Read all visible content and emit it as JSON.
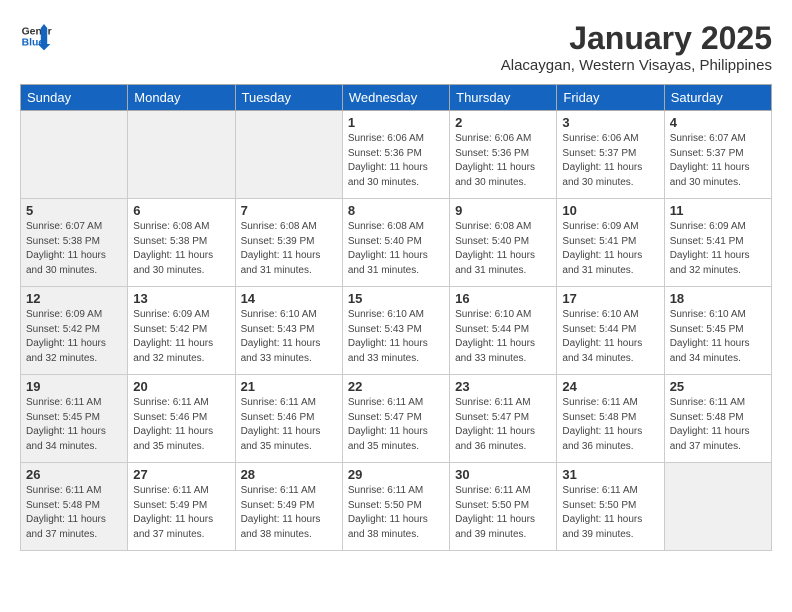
{
  "logo": {
    "general": "General",
    "blue": "Blue"
  },
  "title": {
    "month_year": "January 2025",
    "location": "Alacaygan, Western Visayas, Philippines"
  },
  "headers": [
    "Sunday",
    "Monday",
    "Tuesday",
    "Wednesday",
    "Thursday",
    "Friday",
    "Saturday"
  ],
  "weeks": [
    [
      {
        "day": "",
        "info": "",
        "shaded": true
      },
      {
        "day": "",
        "info": "",
        "shaded": true
      },
      {
        "day": "",
        "info": "",
        "shaded": true
      },
      {
        "day": "1",
        "info": "Sunrise: 6:06 AM\nSunset: 5:36 PM\nDaylight: 11 hours\nand 30 minutes.",
        "shaded": false
      },
      {
        "day": "2",
        "info": "Sunrise: 6:06 AM\nSunset: 5:36 PM\nDaylight: 11 hours\nand 30 minutes.",
        "shaded": false
      },
      {
        "day": "3",
        "info": "Sunrise: 6:06 AM\nSunset: 5:37 PM\nDaylight: 11 hours\nand 30 minutes.",
        "shaded": false
      },
      {
        "day": "4",
        "info": "Sunrise: 6:07 AM\nSunset: 5:37 PM\nDaylight: 11 hours\nand 30 minutes.",
        "shaded": false
      }
    ],
    [
      {
        "day": "5",
        "info": "Sunrise: 6:07 AM\nSunset: 5:38 PM\nDaylight: 11 hours\nand 30 minutes.",
        "shaded": true
      },
      {
        "day": "6",
        "info": "Sunrise: 6:08 AM\nSunset: 5:38 PM\nDaylight: 11 hours\nand 30 minutes.",
        "shaded": false
      },
      {
        "day": "7",
        "info": "Sunrise: 6:08 AM\nSunset: 5:39 PM\nDaylight: 11 hours\nand 31 minutes.",
        "shaded": false
      },
      {
        "day": "8",
        "info": "Sunrise: 6:08 AM\nSunset: 5:40 PM\nDaylight: 11 hours\nand 31 minutes.",
        "shaded": false
      },
      {
        "day": "9",
        "info": "Sunrise: 6:08 AM\nSunset: 5:40 PM\nDaylight: 11 hours\nand 31 minutes.",
        "shaded": false
      },
      {
        "day": "10",
        "info": "Sunrise: 6:09 AM\nSunset: 5:41 PM\nDaylight: 11 hours\nand 31 minutes.",
        "shaded": false
      },
      {
        "day": "11",
        "info": "Sunrise: 6:09 AM\nSunset: 5:41 PM\nDaylight: 11 hours\nand 32 minutes.",
        "shaded": false
      }
    ],
    [
      {
        "day": "12",
        "info": "Sunrise: 6:09 AM\nSunset: 5:42 PM\nDaylight: 11 hours\nand 32 minutes.",
        "shaded": true
      },
      {
        "day": "13",
        "info": "Sunrise: 6:09 AM\nSunset: 5:42 PM\nDaylight: 11 hours\nand 32 minutes.",
        "shaded": false
      },
      {
        "day": "14",
        "info": "Sunrise: 6:10 AM\nSunset: 5:43 PM\nDaylight: 11 hours\nand 33 minutes.",
        "shaded": false
      },
      {
        "day": "15",
        "info": "Sunrise: 6:10 AM\nSunset: 5:43 PM\nDaylight: 11 hours\nand 33 minutes.",
        "shaded": false
      },
      {
        "day": "16",
        "info": "Sunrise: 6:10 AM\nSunset: 5:44 PM\nDaylight: 11 hours\nand 33 minutes.",
        "shaded": false
      },
      {
        "day": "17",
        "info": "Sunrise: 6:10 AM\nSunset: 5:44 PM\nDaylight: 11 hours\nand 34 minutes.",
        "shaded": false
      },
      {
        "day": "18",
        "info": "Sunrise: 6:10 AM\nSunset: 5:45 PM\nDaylight: 11 hours\nand 34 minutes.",
        "shaded": false
      }
    ],
    [
      {
        "day": "19",
        "info": "Sunrise: 6:11 AM\nSunset: 5:45 PM\nDaylight: 11 hours\nand 34 minutes.",
        "shaded": true
      },
      {
        "day": "20",
        "info": "Sunrise: 6:11 AM\nSunset: 5:46 PM\nDaylight: 11 hours\nand 35 minutes.",
        "shaded": false
      },
      {
        "day": "21",
        "info": "Sunrise: 6:11 AM\nSunset: 5:46 PM\nDaylight: 11 hours\nand 35 minutes.",
        "shaded": false
      },
      {
        "day": "22",
        "info": "Sunrise: 6:11 AM\nSunset: 5:47 PM\nDaylight: 11 hours\nand 35 minutes.",
        "shaded": false
      },
      {
        "day": "23",
        "info": "Sunrise: 6:11 AM\nSunset: 5:47 PM\nDaylight: 11 hours\nand 36 minutes.",
        "shaded": false
      },
      {
        "day": "24",
        "info": "Sunrise: 6:11 AM\nSunset: 5:48 PM\nDaylight: 11 hours\nand 36 minutes.",
        "shaded": false
      },
      {
        "day": "25",
        "info": "Sunrise: 6:11 AM\nSunset: 5:48 PM\nDaylight: 11 hours\nand 37 minutes.",
        "shaded": false
      }
    ],
    [
      {
        "day": "26",
        "info": "Sunrise: 6:11 AM\nSunset: 5:48 PM\nDaylight: 11 hours\nand 37 minutes.",
        "shaded": true
      },
      {
        "day": "27",
        "info": "Sunrise: 6:11 AM\nSunset: 5:49 PM\nDaylight: 11 hours\nand 37 minutes.",
        "shaded": false
      },
      {
        "day": "28",
        "info": "Sunrise: 6:11 AM\nSunset: 5:49 PM\nDaylight: 11 hours\nand 38 minutes.",
        "shaded": false
      },
      {
        "day": "29",
        "info": "Sunrise: 6:11 AM\nSunset: 5:50 PM\nDaylight: 11 hours\nand 38 minutes.",
        "shaded": false
      },
      {
        "day": "30",
        "info": "Sunrise: 6:11 AM\nSunset: 5:50 PM\nDaylight: 11 hours\nand 39 minutes.",
        "shaded": false
      },
      {
        "day": "31",
        "info": "Sunrise: 6:11 AM\nSunset: 5:50 PM\nDaylight: 11 hours\nand 39 minutes.",
        "shaded": false
      },
      {
        "day": "",
        "info": "",
        "shaded": true
      }
    ]
  ]
}
